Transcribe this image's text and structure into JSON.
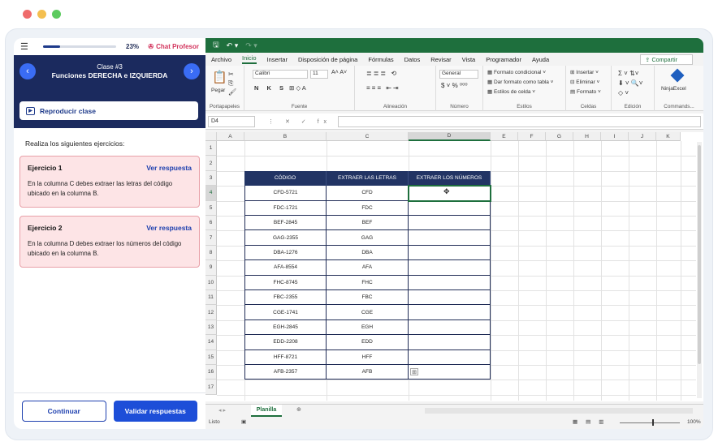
{
  "lesson": {
    "progress_percent": 23,
    "progress_label": "23%",
    "chat_label": "Chat Profesor",
    "class_label": "Clase #3",
    "title": "Funciones DERECHA e IZQUIERDA",
    "play_label": "Reproducir clase",
    "intro": "Realiza los siguientes ejercicios:",
    "exercises": [
      {
        "title": "Ejercicio 1",
        "link": "Ver respuesta",
        "text": "En la columna C debes extraer las letras del código ubicado en la columna B."
      },
      {
        "title": "Ejercicio 2",
        "link": "Ver respuesta",
        "text": "En la columna D debes extraer los números del código ubicado en la columna B."
      }
    ],
    "continue_label": "Continuar",
    "validate_label": "Validar respuestas"
  },
  "excel": {
    "menu": [
      "Archivo",
      "Inicio",
      "Insertar",
      "Disposición de página",
      "Fórmulas",
      "Datos",
      "Revisar",
      "Vista",
      "Programador",
      "Ayuda"
    ],
    "active_menu": "Inicio",
    "share_label": "Compartir",
    "ribbon": {
      "portapapeles": "Portapapeles",
      "pegar": "Pegar",
      "fuente": "Fuente",
      "font_name": "Calibri",
      "font_size": "11",
      "alineacion": "Alineación",
      "numero": "Número",
      "number_format": "General",
      "estilos": "Estilos",
      "formato_condicional": "Formato condicional",
      "dar_formato_tabla": "Dar formato como tabla",
      "estilos_celda": "Estilos de celda",
      "celdas": "Celdas",
      "insertar": "Insertar",
      "eliminar": "Eliminar",
      "formato": "Formato",
      "edicion": "Edición",
      "ninja": "NinjaExcel",
      "commands": "Commands..."
    },
    "name_box": "D4",
    "columns": [
      "A",
      "B",
      "C",
      "D",
      "E",
      "F",
      "G",
      "H",
      "I",
      "J",
      "K"
    ],
    "rows": [
      "1",
      "2",
      "3",
      "4",
      "5",
      "6",
      "7",
      "8",
      "9",
      "10",
      "11",
      "12",
      "13",
      "14",
      "15",
      "16",
      "17"
    ],
    "table_headers": [
      "CÓDIGO",
      "EXTRAER LAS LETRAS",
      "EXTRAER LOS NÚMEROS"
    ],
    "table_rows": [
      [
        "CFD-5721",
        "CFD",
        ""
      ],
      [
        "FDC-1721",
        "FDC",
        ""
      ],
      [
        "BEF-2845",
        "BEF",
        ""
      ],
      [
        "GAG-2355",
        "GAG",
        ""
      ],
      [
        "DBA-1276",
        "DBA",
        ""
      ],
      [
        "AFA-8554",
        "AFA",
        ""
      ],
      [
        "FHC-8745",
        "FHC",
        ""
      ],
      [
        "FBC-2355",
        "FBC",
        ""
      ],
      [
        "CGE-1741",
        "CGE",
        ""
      ],
      [
        "EGH-2845",
        "EGH",
        ""
      ],
      [
        "EDD-2208",
        "EDD",
        ""
      ],
      [
        "HFF-8721",
        "HFF",
        ""
      ],
      [
        "AFB-2357",
        "AFB",
        ""
      ]
    ],
    "sheet_tab": "Planilla",
    "status_left": "Listo",
    "zoom": "100%"
  },
  "colors": {
    "accent": "#1e6f3d",
    "lesson_bg": "#1b2a5e",
    "table_header": "#223464",
    "exercise_bg": "#fde4e6"
  }
}
